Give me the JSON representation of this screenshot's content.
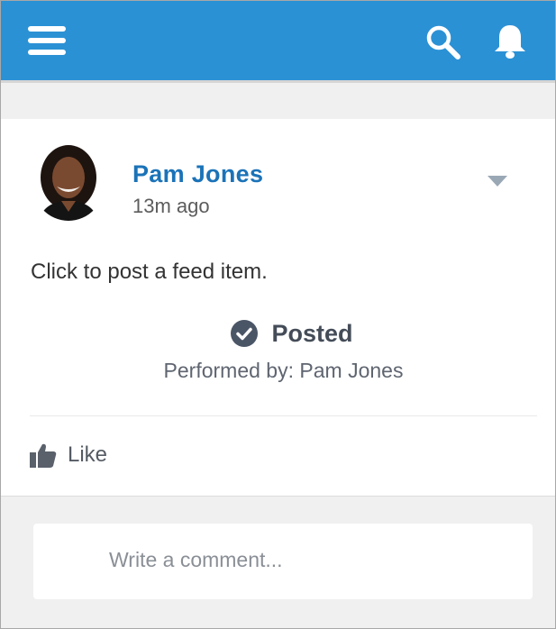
{
  "header": {
    "menu_icon": "hamburger-menu-icon",
    "search_icon": "search-icon",
    "notifications_icon": "bell-icon",
    "bar_color": "#2b91d5"
  },
  "post": {
    "author": "Pam Jones",
    "time": "13m ago",
    "text": "Click to post a feed item.",
    "status": "Posted",
    "performed_by": "Performed by: Pam Jones",
    "like_label": "Like",
    "author_color": "#1b73b8"
  },
  "comment": {
    "placeholder": "Write a comment..."
  }
}
